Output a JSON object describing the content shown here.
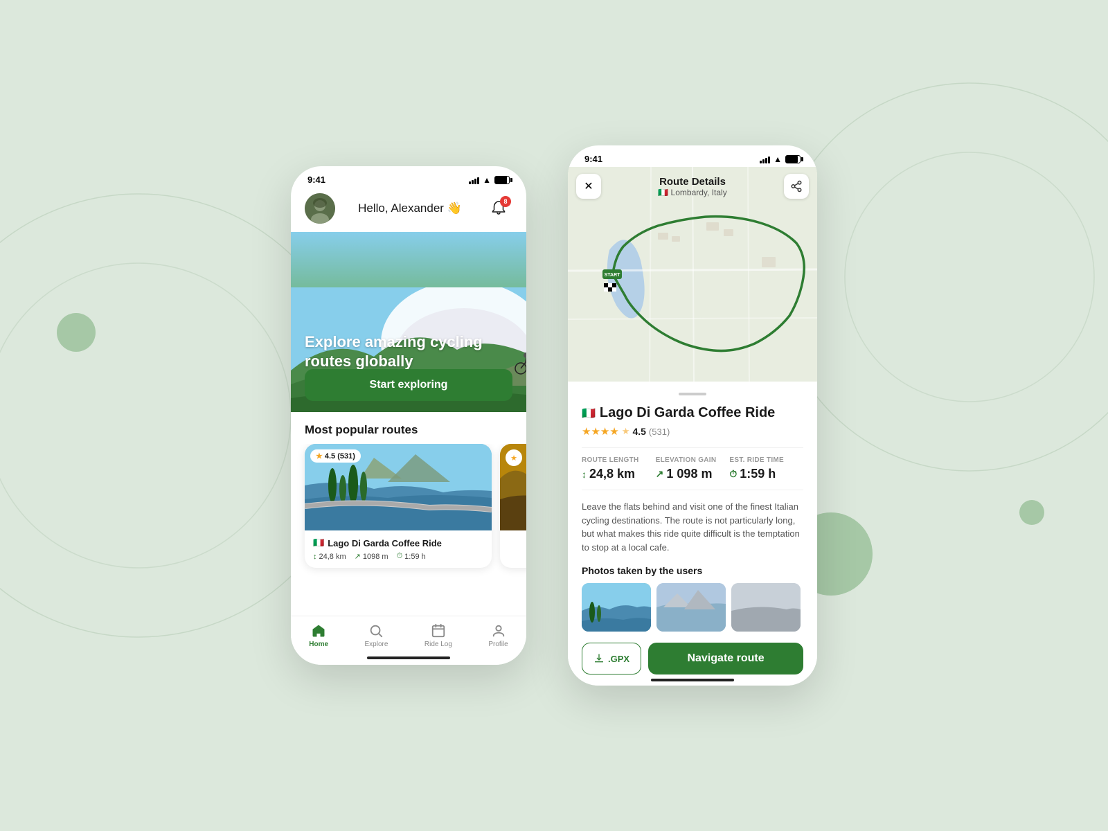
{
  "background": {
    "color": "#dce8dc"
  },
  "phone_left": {
    "status_bar": {
      "time": "9:41"
    },
    "header": {
      "greeting": "Hello, Alexander 👋",
      "notification_count": "8"
    },
    "hero": {
      "title": "Explore amazing cycling routes globally",
      "cta_label": "Start exploring"
    },
    "popular_routes": {
      "section_title": "Most popular routes",
      "cards": [
        {
          "name": "Lago Di Garda Coffee Ride",
          "flag": "🇮🇹",
          "rating": "4.5",
          "review_count": "531",
          "distance": "24,8 km",
          "elevation": "1098 m",
          "ride_time": "1:59 h"
        }
      ]
    },
    "bottom_nav": {
      "items": [
        {
          "icon": "🏠",
          "label": "Home",
          "active": true
        },
        {
          "icon": "🔍",
          "label": "Explore",
          "active": false
        },
        {
          "icon": "📅",
          "label": "Ride Log",
          "active": false
        },
        {
          "icon": "👤",
          "label": "Profile",
          "active": false
        }
      ]
    }
  },
  "phone_right": {
    "status_bar": {
      "time": "9:41"
    },
    "map_header": {
      "title": "Route Details",
      "location": "🇮🇹 Lombardy, Italy",
      "close_icon": "✕",
      "share_icon": "⊙"
    },
    "route": {
      "flag": "🇮🇹",
      "name": "Lago Di Garda Coffee Ride",
      "rating": "4.5",
      "review_count": "531",
      "stars": "★★★★½",
      "metrics": {
        "distance": {
          "label": "ROUTE LENGTH",
          "value": "24,8 km",
          "icon": "↕"
        },
        "elevation": {
          "label": "ELEVATION GAIN",
          "value": "1 098 m",
          "icon": "↗"
        },
        "ride_time": {
          "label": "EST. RIDE TIME",
          "value": "1:59 h",
          "icon": "⏱"
        }
      },
      "description": "Leave the flats behind and visit one of the finest Italian cycling destinations. The route is not particularly long, but what makes this ride quite difficult is the temptation to stop at a local cafe.",
      "photos_title": "Photos taken by the users"
    },
    "actions": {
      "gpx_label": ".GPX",
      "navigate_label": "Navigate route"
    }
  }
}
